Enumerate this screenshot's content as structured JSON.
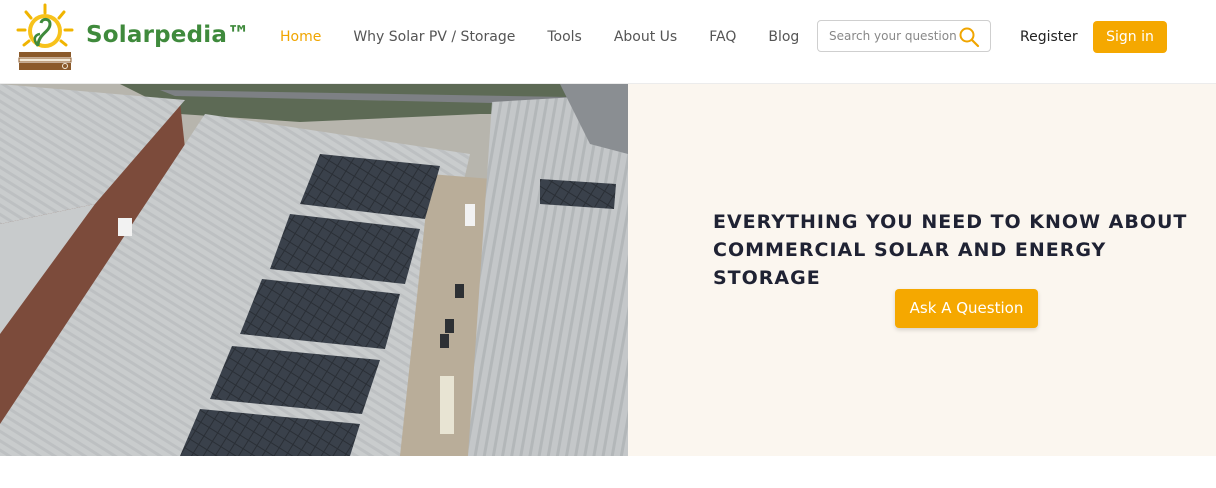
{
  "header": {
    "brand": "Solarpedia™",
    "nav": [
      {
        "label": "Home",
        "active": true
      },
      {
        "label": "Why Solar PV / Storage",
        "active": false
      },
      {
        "label": "Tools",
        "active": false
      },
      {
        "label": "About Us",
        "active": false
      },
      {
        "label": "FAQ",
        "active": false
      },
      {
        "label": "Blog",
        "active": false
      }
    ],
    "search": {
      "placeholder": "Search your question",
      "value": "",
      "icon": "search-icon"
    },
    "register_label": "Register",
    "signin_label": "Sign in"
  },
  "hero": {
    "image": "aerial-rooftop-solar-photo",
    "headline_line1": "EVERYTHING YOU NEED TO KNOW ABOUT",
    "headline_line2": "COMMERCIAL SOLAR AND ENERGY STORAGE",
    "cta_label": "Ask A Question"
  },
  "colors": {
    "accent": "#f5a800",
    "brand_green": "#3f8a3c",
    "hero_panel_bg": "#fbf6ef",
    "headline": "#1f2233"
  }
}
